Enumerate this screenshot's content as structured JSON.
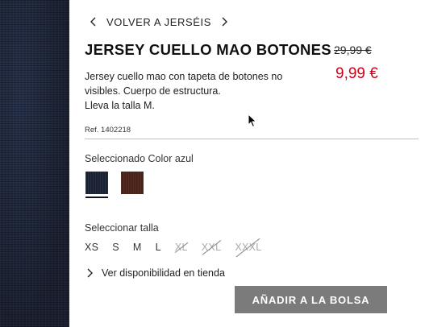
{
  "nav": {
    "back_label": "VOLVER A JERSÉIS"
  },
  "product": {
    "title": "JERSEY CUELLO MAO BOTONES",
    "old_price": "29,99 €",
    "new_price": "9,99 €",
    "description_lines": [
      "Jersey cuello mao con tapeta de botones no",
      "visibles. Cuerpo de estructura.",
      "Lleva la talla M."
    ],
    "ref": "Ref. 1402218"
  },
  "color": {
    "label": "Seleccionado Color azul",
    "swatches": [
      {
        "name": "azul",
        "hex": "#1a2234",
        "selected": true
      },
      {
        "name": "marrón",
        "hex": "#4a2218",
        "selected": false
      }
    ]
  },
  "size": {
    "label": "Seleccionar talla",
    "options": [
      {
        "label": "XS",
        "available": true
      },
      {
        "label": "S",
        "available": true
      },
      {
        "label": "M",
        "available": true
      },
      {
        "label": "L",
        "available": true
      },
      {
        "label": "XL",
        "available": false
      },
      {
        "label": "XXL",
        "available": false
      },
      {
        "label": "XXXL",
        "available": false
      }
    ]
  },
  "store": {
    "availability_label": "Ver disponibilidad en tienda"
  },
  "cart": {
    "add_label": "AÑADIR A LA BOLSA"
  },
  "colors": {
    "price_red": "#d0021b",
    "button_gray": "#7b7b7b"
  },
  "icons": {
    "nav_prev": "chevron-left-icon",
    "nav_next": "chevron-right-icon",
    "availability": "chevron-right-icon"
  }
}
